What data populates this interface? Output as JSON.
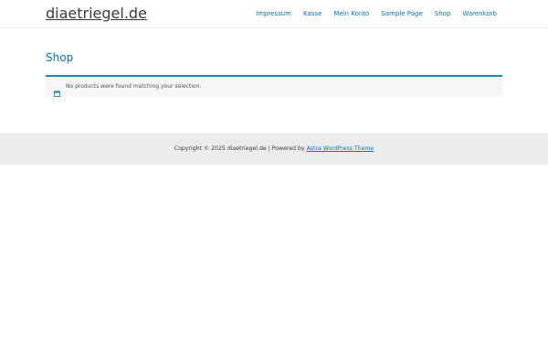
{
  "header": {
    "site_title": "diaetriegel.de",
    "nav": [
      {
        "label": "Impressum"
      },
      {
        "label": "Kasse"
      },
      {
        "label": "Mein Konto"
      },
      {
        "label": "Sample Page"
      },
      {
        "label": "Shop"
      },
      {
        "label": "Warenkorb"
      }
    ]
  },
  "main": {
    "page_title": "Shop",
    "notice": {
      "icon": "calendar-icon",
      "text": "No products were found matching your selection."
    }
  },
  "footer": {
    "copyright_text": "Copyright © 2025 diaetriegel.de | Powered by",
    "theme_link": "Astra WordPress Theme"
  },
  "colors": {
    "accent": "#0274be",
    "notice_border": "#1e85be",
    "footer_bg": "#ececec",
    "text": "#3a3a3a"
  }
}
